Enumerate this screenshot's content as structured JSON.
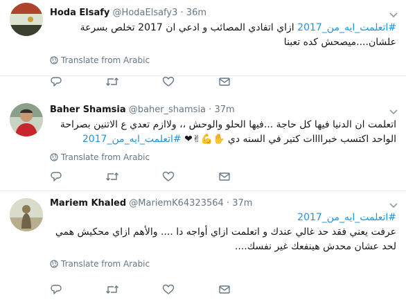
{
  "tweets": [
    {
      "name": "Hoda Elsafy",
      "handle": "@HodaElsafy3",
      "separator": "·",
      "time": "36m",
      "body_tag": "#اتعلمت_ايه_من_2017",
      "body_text": " ازاي اتفادي المصائب و ادعي ان 2017 تخلص بسرعة علشان....ميصحش كده تعبنا",
      "translate": "Translate from Arabic",
      "avatar": "flag-egypt"
    },
    {
      "name": "Baher Shamsia",
      "handle": "@baher_shamsia",
      "separator": "·",
      "time": "37m",
      "body_text": "اتعلمت ان الدنيا فيها كل حاجة ...فيها الحلو والوحش ،، ولاازم تعدي ع الاتنين بصراحة الواحد اكتسب خبراااات كتير في السنه دي",
      "body_emoji": "✋💪✌❤",
      "body_tag": " #اتعلمت_ايه_من_2017",
      "translate": "Translate from Arabic",
      "avatar": "photo-man-red-shirt"
    },
    {
      "name": "Mariem Khaled",
      "handle": "@MariemK64323564",
      "separator": "·",
      "time": "37m",
      "body_tag": "#اتعلمت_ايه_من_2017",
      "body_text": "عرفت يعني فقد حد غالي عندك و اتعلمت ازاي أواجه دا .... والأهم ازاي محكيش همي لحد عشان محدش هينفعك غير نفسك....",
      "translate": "Translate from Arabic",
      "avatar": "photo-figure"
    }
  ],
  "colors": {
    "link": "#1b95e0",
    "muted": "#657786",
    "divider": "#e6ecf0"
  },
  "icons": [
    "globe-icon",
    "reply-icon",
    "retweet-icon",
    "like-icon",
    "message-icon",
    "caret-down-icon"
  ]
}
